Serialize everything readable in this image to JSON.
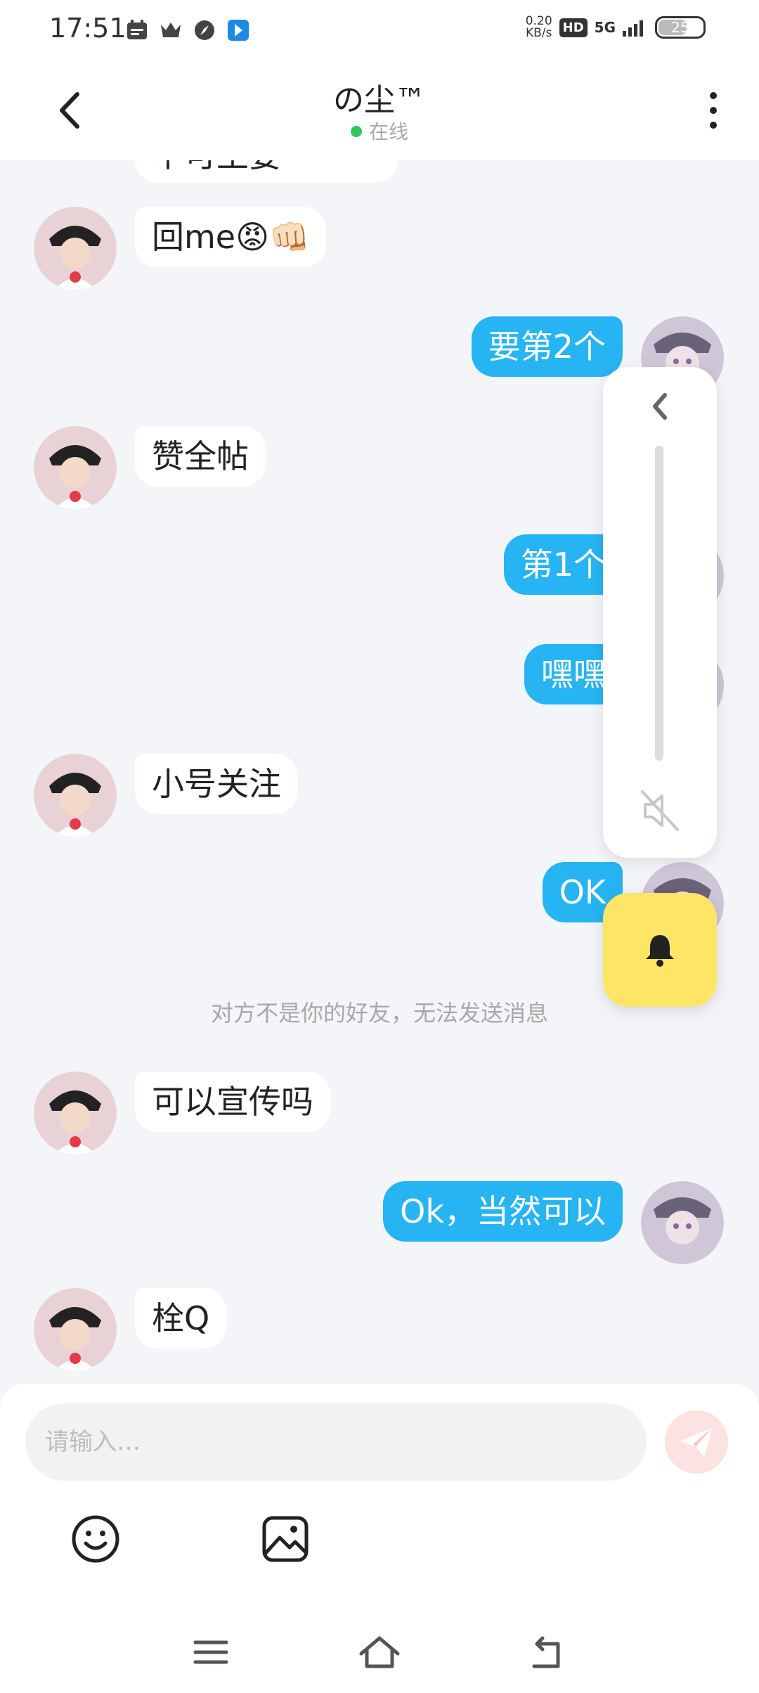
{
  "status_bar": {
    "time": "17:51",
    "net_speed_value": "0.20",
    "net_speed_unit": "KB/s",
    "hd": "HD",
    "signal": "5G",
    "battery": "25"
  },
  "header": {
    "title": "の尘™",
    "status": "在线"
  },
  "messages": [
    {
      "side": "in",
      "text": "回me😡👊🏻"
    },
    {
      "side": "out",
      "text": "要第2个"
    },
    {
      "side": "in",
      "text": "赞全帖"
    },
    {
      "side": "out",
      "text": "第1个"
    },
    {
      "side": "out",
      "text": "嘿嘿"
    },
    {
      "side": "in",
      "text": "小号关注"
    },
    {
      "side": "out",
      "text": "OK"
    },
    {
      "side": "in",
      "text": "可以宣传吗"
    },
    {
      "side": "out",
      "text": "Ok，当然可以"
    },
    {
      "side": "in",
      "text": "栓Q"
    }
  ],
  "partial_top_message": "不可王要",
  "system_notice": "对方不是你的好友，无法发送消息",
  "input": {
    "placeholder": "请输入…"
  },
  "colors": {
    "outgoing_bubble": "#27b4f2",
    "incoming_bubble": "#ffffff",
    "background": "#f3f5f8",
    "bell_button": "#ffe566",
    "online_dot": "#2fc75a"
  },
  "icons": {
    "back": "chevron-left-icon",
    "more": "vertical-dots-icon",
    "send": "paper-plane-icon",
    "emoji": "smiley-icon",
    "image": "image-icon",
    "volume_collapse": "chevron-left-icon",
    "mute": "speaker-muted-icon",
    "bell": "bell-icon",
    "nav_menu": "menu-icon",
    "nav_home": "home-icon",
    "nav_back": "back-arrow-icon"
  }
}
